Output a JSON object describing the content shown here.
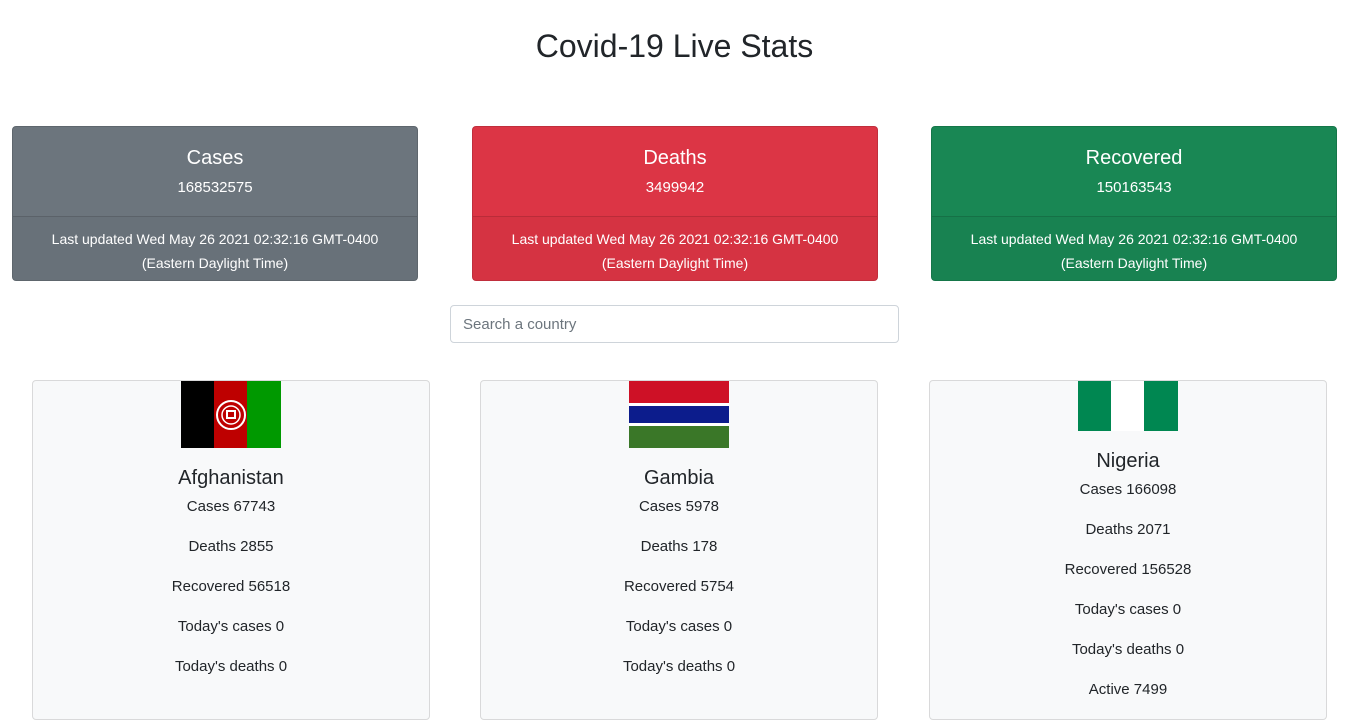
{
  "page": {
    "title": "Covid-19 Live Stats"
  },
  "summary": {
    "cases": {
      "title": "Cases",
      "value": "168532575",
      "updated_line1": "Last updated Wed May 26 2021 02:32:16 GMT-0400",
      "updated_line2": "(Eastern Daylight Time)",
      "color": "#6c757d"
    },
    "deaths": {
      "title": "Deaths",
      "value": "3499942",
      "updated_line1": "Last updated Wed May 26 2021 02:32:16 GMT-0400",
      "updated_line2": "(Eastern Daylight Time)",
      "color": "#dc3545"
    },
    "recovered": {
      "title": "Recovered",
      "value": "150163543",
      "updated_line1": "Last updated Wed May 26 2021 02:32:16 GMT-0400",
      "updated_line2": "(Eastern Daylight Time)",
      "color": "#198754"
    }
  },
  "search": {
    "placeholder": "Search a country",
    "value": ""
  },
  "countries": [
    {
      "name": "Afghanistan",
      "flag_icon": "afghanistan-flag-icon",
      "cases": "Cases 67743",
      "deaths": "Deaths 2855",
      "recovered": "Recovered 56518",
      "today_cases": "Today's cases 0",
      "today_deaths": "Today's deaths 0"
    },
    {
      "name": "Gambia",
      "flag_icon": "gambia-flag-icon",
      "cases": "Cases 5978",
      "deaths": "Deaths 178",
      "recovered": "Recovered 5754",
      "today_cases": "Today's cases 0",
      "today_deaths": "Today's deaths 0"
    },
    {
      "name": "Nigeria",
      "flag_icon": "nigeria-flag-icon",
      "cases": "Cases 166098",
      "deaths": "Deaths 2071",
      "recovered": "Recovered 156528",
      "today_cases": "Today's cases 0",
      "today_deaths": "Today's deaths 0",
      "active": "Active 7499"
    }
  ]
}
